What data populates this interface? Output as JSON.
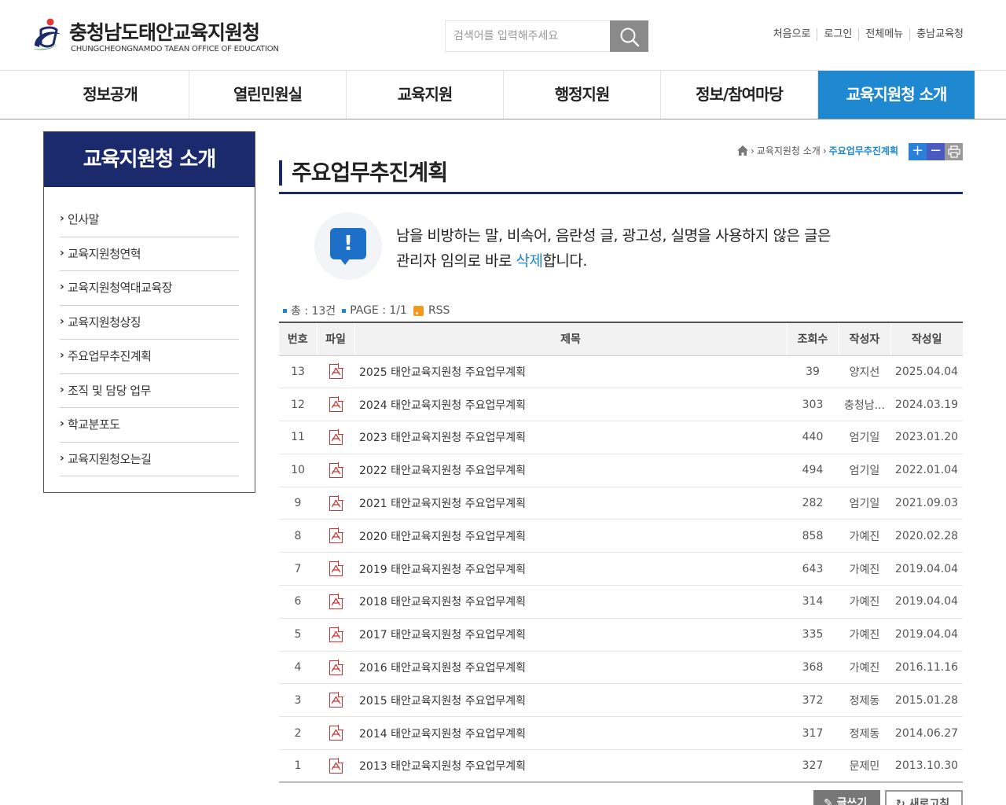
{
  "header": {
    "logo_title": "충청남도태안교육지원청",
    "logo_subtitle": "CHUNGCHEONGNAMDO TAEAN OFFICE OF EDUCATION",
    "search_placeholder": "검색어를 입력해주세요",
    "util_links": [
      "처음으로",
      "로그인",
      "전체메뉴",
      "충남교육청"
    ]
  },
  "gnb": {
    "items": [
      "정보공개",
      "열린민원실",
      "교육지원",
      "행정지원",
      "정보/참여마당",
      "교육지원청 소개"
    ],
    "active_index": 5
  },
  "lnb": {
    "title": "교육지원청 소개",
    "items": [
      "인사말",
      "교육지원청연혁",
      "교육지원청역대교육장",
      "교육지원청상징",
      "주요업무추진계획",
      "조직 및 담당 업무",
      "학교분포도",
      "교육지원청오는길"
    ]
  },
  "breadcrumb": {
    "parent": "교육지원청 소개",
    "current": "주요업무추진계획"
  },
  "tools": {
    "plus": "+",
    "minus": "−"
  },
  "page_title": "주요업무추진계획",
  "notice": {
    "icon_char": "!",
    "line1": "남을 비방하는 말, 비속어, 음란성 글, 광고성, 실명을 사용하지 않은 글은",
    "line2_before": "관리자 임의로 바로 ",
    "line2_highlight": "삭제",
    "line2_after": "합니다."
  },
  "board_info": {
    "total": "총 : 13건",
    "page": "PAGE : 1/1",
    "rss": "RSS"
  },
  "table": {
    "headers": [
      "번호",
      "파일",
      "제목",
      "조회수",
      "작성자",
      "작성일"
    ],
    "rows": [
      {
        "no": "13",
        "title": "2025 태안교육지원청 주요업무계획",
        "views": "39",
        "author": "양지선",
        "date": "2025.04.04"
      },
      {
        "no": "12",
        "title": "2024 태안교육지원청 주요업무계획",
        "views": "303",
        "author": "충청남...",
        "date": "2024.03.19"
      },
      {
        "no": "11",
        "title": "2023 태안교육지원청 주요업무계획",
        "views": "440",
        "author": "엄기일",
        "date": "2023.01.20"
      },
      {
        "no": "10",
        "title": "2022 태안교육지원청 주요업무계획",
        "views": "494",
        "author": "엄기일",
        "date": "2022.01.04"
      },
      {
        "no": "9",
        "title": "2021 태안교육지원청 주요업무계획",
        "views": "282",
        "author": "엄기일",
        "date": "2021.09.03"
      },
      {
        "no": "8",
        "title": "2020 태안교육지원청 주요업무계획",
        "views": "858",
        "author": "가예진",
        "date": "2020.02.28"
      },
      {
        "no": "7",
        "title": "2019 태안교육지원청 주요업무계획",
        "views": "643",
        "author": "가예진",
        "date": "2019.04.04"
      },
      {
        "no": "6",
        "title": "2018 태안교육지원청 주요업무계획",
        "views": "314",
        "author": "가예진",
        "date": "2019.04.04"
      },
      {
        "no": "5",
        "title": "2017 태안교육지원청 주요업무계획",
        "views": "335",
        "author": "가예진",
        "date": "2019.04.04"
      },
      {
        "no": "4",
        "title": "2016 태안교육지원청 주요업무계획",
        "views": "368",
        "author": "가예진",
        "date": "2016.11.16"
      },
      {
        "no": "3",
        "title": "2015 태안교육지원청 주요업무계획",
        "views": "372",
        "author": "정제동",
        "date": "2015.01.28"
      },
      {
        "no": "2",
        "title": "2014 태안교육지원청 주요업무계획",
        "views": "317",
        "author": "정제동",
        "date": "2014.06.27"
      },
      {
        "no": "1",
        "title": "2013 태안교육지원청 주요업무계획",
        "views": "327",
        "author": "문제민",
        "date": "2013.10.30"
      }
    ]
  },
  "buttons": {
    "write": "글쓰기",
    "refresh": "새로고침"
  },
  "colors": {
    "primary_navy": "#1a2a6c",
    "accent_blue": "#1e88d1",
    "pdf_red": "#d32f2f"
  }
}
